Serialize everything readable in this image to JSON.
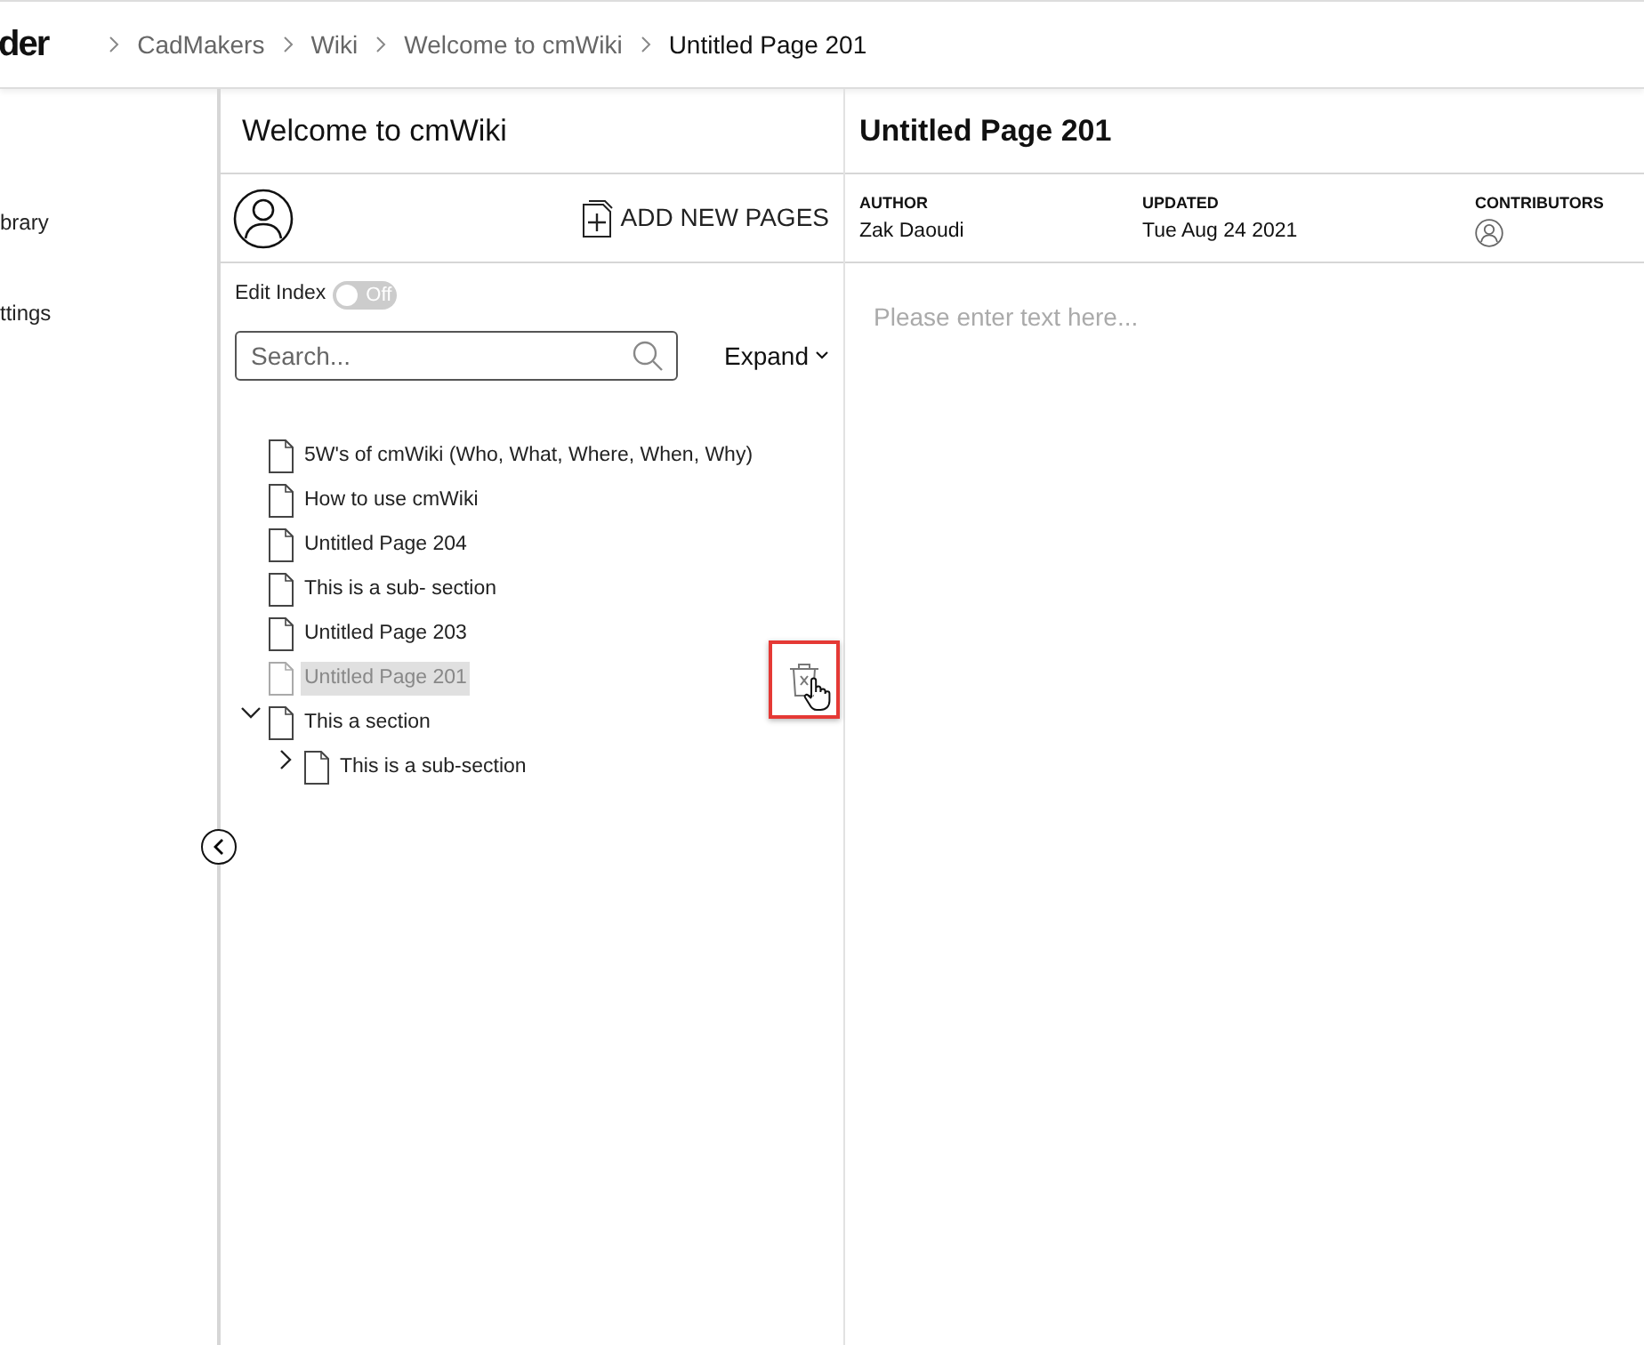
{
  "logo": "der",
  "breadcrumb": [
    {
      "label": "CadMakers",
      "current": false
    },
    {
      "label": "Wiki",
      "current": false
    },
    {
      "label": "Welcome to cmWiki",
      "current": false
    },
    {
      "label": "Untitled Page 201",
      "current": true
    }
  ],
  "sidebar": {
    "items": [
      "brary",
      "ttings"
    ]
  },
  "index_panel": {
    "title": "Welcome to cmWiki",
    "add_button": "ADD NEW PAGES",
    "edit_index": {
      "label": "Edit Index",
      "on": false,
      "state_text": "Off"
    },
    "search": {
      "placeholder": "Search..."
    },
    "expand_button": "Expand",
    "tree": [
      {
        "label": "5W's of cmWiki (Who, What, Where, When, Why)",
        "selected": false
      },
      {
        "label": "How to use cmWiki",
        "selected": false
      },
      {
        "label": "Untitled Page 204",
        "selected": false
      },
      {
        "label": "This is a sub- section",
        "selected": false
      },
      {
        "label": "Untitled Page 203",
        "selected": false
      },
      {
        "label": "Untitled Page 201",
        "selected": true
      },
      {
        "label": "This a section",
        "selected": false,
        "expanded": true,
        "children": [
          {
            "label": "This is a sub-section",
            "selected": false,
            "expanded": false
          }
        ]
      }
    ]
  },
  "page": {
    "title": "Untitled Page 201",
    "meta": [
      {
        "kind": "text",
        "label": "AUTHOR",
        "value": "Zak Daoudi"
      },
      {
        "kind": "text",
        "label": "UPDATED",
        "value": "Tue Aug 24 2021"
      },
      {
        "kind": "avatars",
        "label": "CONTRIBUTORS"
      }
    ],
    "placeholder": "Please enter text here..."
  }
}
